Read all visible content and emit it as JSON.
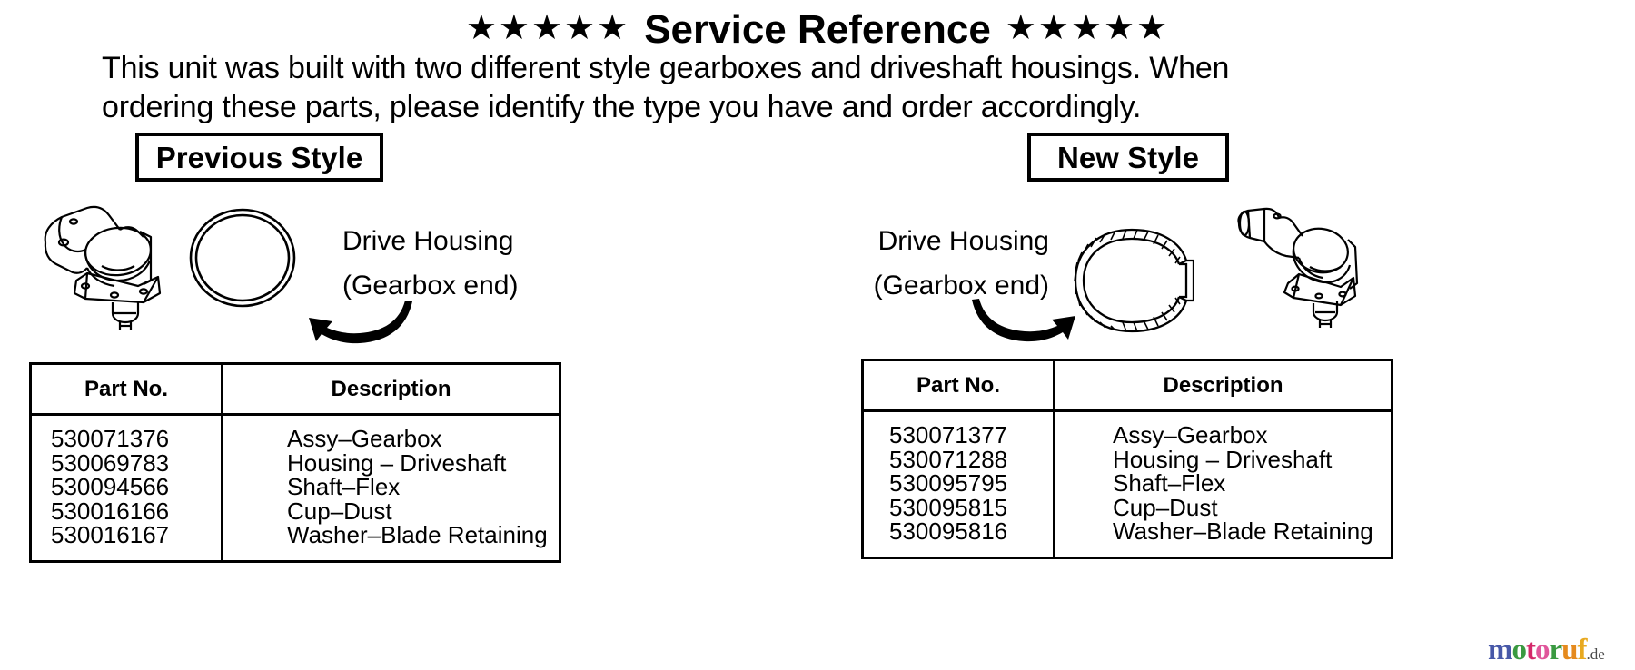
{
  "header": {
    "stars_left": "★★★★★",
    "title": "Service Reference",
    "stars_right": "★★★★★",
    "intro_line1": "This unit was built with  two different style gearboxes and driveshaft housings. When",
    "intro_line2": "ordering these parts, please identify the type you have and order accordingly."
  },
  "previous": {
    "style_label": "Previous Style",
    "figure_label_line1": "Drive Housing",
    "figure_label_line2": "(Gearbox end)",
    "table": {
      "headers": {
        "part_no": "Part No.",
        "description": "Description"
      },
      "rows": [
        {
          "part_no": "530071376",
          "description": "Assy–Gearbox"
        },
        {
          "part_no": "530069783",
          "description": "Housing – Driveshaft"
        },
        {
          "part_no": "530094566",
          "description": "Shaft–Flex"
        },
        {
          "part_no": "530016166",
          "description": "Cup–Dust"
        },
        {
          "part_no": "530016167",
          "description": "Washer–Blade  Retaining"
        }
      ]
    }
  },
  "new": {
    "style_label": "New Style",
    "figure_label_line1": "Drive Housing",
    "figure_label_line2": "(Gearbox end)",
    "table": {
      "headers": {
        "part_no": "Part No.",
        "description": "Description"
      },
      "rows": [
        {
          "part_no": "530071377",
          "description": "Assy–Gearbox"
        },
        {
          "part_no": "530071288",
          "description": "Housing – Driveshaft"
        },
        {
          "part_no": "530095795",
          "description": "Shaft–Flex"
        },
        {
          "part_no": "530095815",
          "description": "Cup–Dust"
        },
        {
          "part_no": "530095816",
          "description": "Washer–Blade  Retaining"
        }
      ]
    }
  },
  "watermark": {
    "letters": [
      {
        "ch": "m",
        "color": "#4758a8"
      },
      {
        "ch": "o",
        "color": "#3a9a41"
      },
      {
        "ch": "t",
        "color": "#d4286a"
      },
      {
        "ch": "o",
        "color": "#e0569b"
      },
      {
        "ch": "r",
        "color": "#3a9a41"
      },
      {
        "ch": "u",
        "color": "#e58a1e"
      },
      {
        "ch": "f",
        "color": "#e8a920"
      }
    ],
    "suffix": ".de"
  }
}
